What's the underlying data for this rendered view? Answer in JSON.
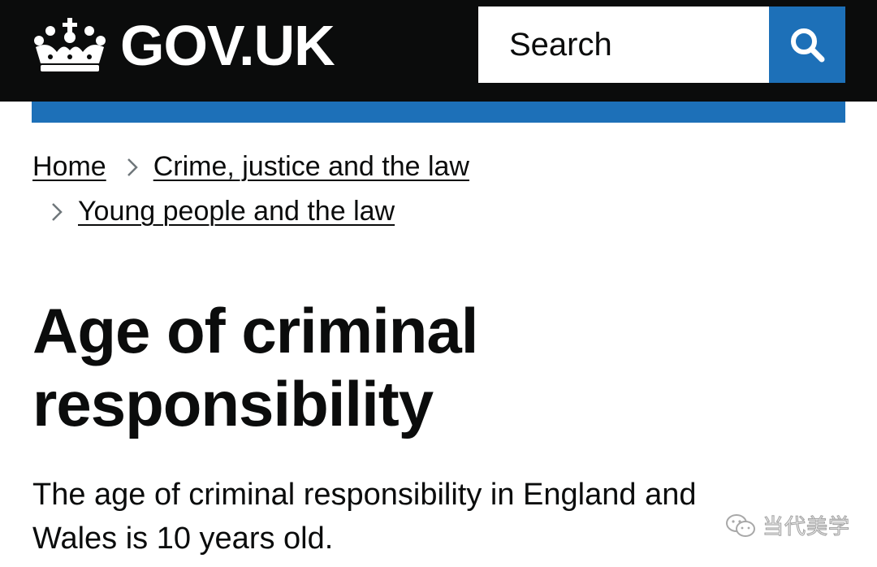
{
  "header": {
    "logo_text": "GOV.UK",
    "logo_icon": "crown-icon",
    "search": {
      "placeholder": "Search",
      "button_icon": "search-icon"
    },
    "colors": {
      "header_bg": "#0b0c0c",
      "accent_blue": "#1d70b8"
    }
  },
  "breadcrumb": {
    "items": [
      "Home",
      "Crime, justice and the law",
      "Young people and the law"
    ],
    "separator_icon": "chevron-right-icon"
  },
  "main": {
    "title": "Age of criminal responsibility",
    "lead": "The age of criminal responsibility in England and Wales is 10 years old."
  },
  "watermark": {
    "text": "当代美学",
    "icon": "wechat-icon"
  }
}
